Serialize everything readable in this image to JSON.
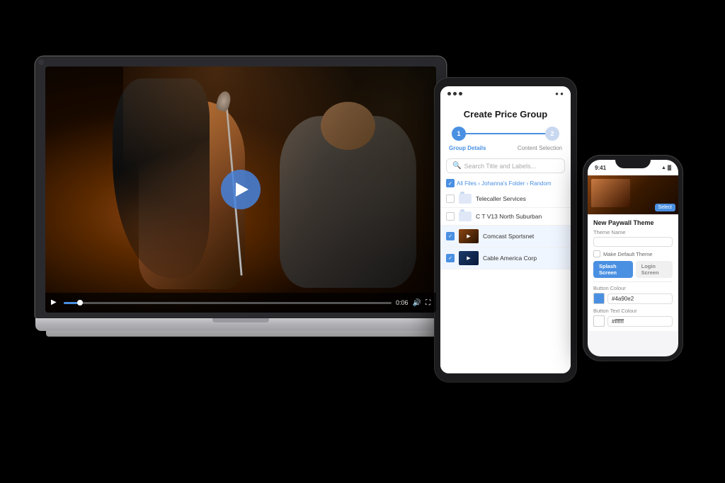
{
  "scene": {
    "bg": "#000000"
  },
  "laptop": {
    "video": {
      "play_btn_label": "Play",
      "time": "0:06",
      "time_full": "0:06"
    }
  },
  "tablet": {
    "title": "Create Price Group",
    "steps": {
      "step1_label": "Group Details",
      "step2_label": "Content Selection",
      "step1_num": "1",
      "step2_num": "2"
    },
    "search_placeholder": "Search Title and Labels...",
    "breadcrumb": "All Files › Johanna's Folder › Random",
    "files": [
      {
        "name": "Telecaller Services",
        "type": "folder",
        "checked": false
      },
      {
        "name": "C T V13 North Suburban",
        "type": "folder",
        "checked": false
      },
      {
        "name": "Comcast Sportsnet",
        "type": "video",
        "checked": true
      },
      {
        "name": "Cable America Corp",
        "type": "video",
        "checked": true
      }
    ]
  },
  "phone": {
    "time": "9:41",
    "title": "New Paywall Theme",
    "fields": {
      "theme_name_label": "Theme Name",
      "theme_name_value": "",
      "default_label": "Make Default Theme",
      "splash_label": "Splash Screen",
      "login_label": "Login Screen",
      "button_color_label": "Button Colour",
      "button_color_value": "#4a90e2",
      "button_text_label": "Button Text Colour",
      "button_text_value": "#ffffff"
    },
    "tabs": {
      "splash": "Splash Screen",
      "login": "Login Screen"
    }
  }
}
